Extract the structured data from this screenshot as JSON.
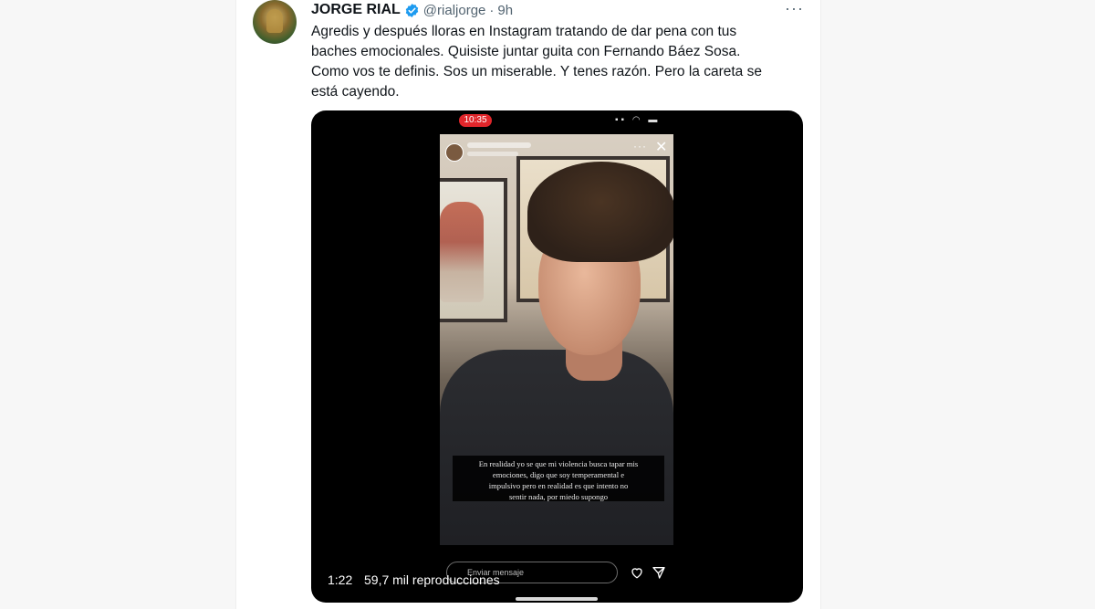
{
  "tweet": {
    "display_name": "JORGE RIAL",
    "handle": "@rialjorge",
    "separator": " · ",
    "time": "9h",
    "text_lines": [
      "Agredis y después lloras en Instagram tratando de dar pena con tus",
      "baches emocionales. Quisiste juntar guita con Fernando Báez Sosa.",
      "Como vos te definis. Sos un miserable. Y tenes razón. Pero la careta se",
      "está cayendo."
    ]
  },
  "video": {
    "phone_time": "10:35",
    "caption_lines": [
      "En realidad yo se que mi violencia busca tapar mis",
      "emociones, digo que soy temperamental e",
      "impulsivo pero en realidad es que intento no",
      "sentir nada, por miedo supongo"
    ],
    "message_placeholder": "Enviar mensaje",
    "duration": "1:22",
    "views": "59,7 mil reproducciones"
  },
  "colors": {
    "verified": "#1d9bf0",
    "text_primary": "#0f1419",
    "text_secondary": "#536471",
    "recording_pill": "#e0262b"
  },
  "icons": {
    "verified": "verified-badge-icon",
    "more": "more-horizontal-icon",
    "heart": "heart-icon",
    "send": "send-icon",
    "close": "close-icon"
  }
}
